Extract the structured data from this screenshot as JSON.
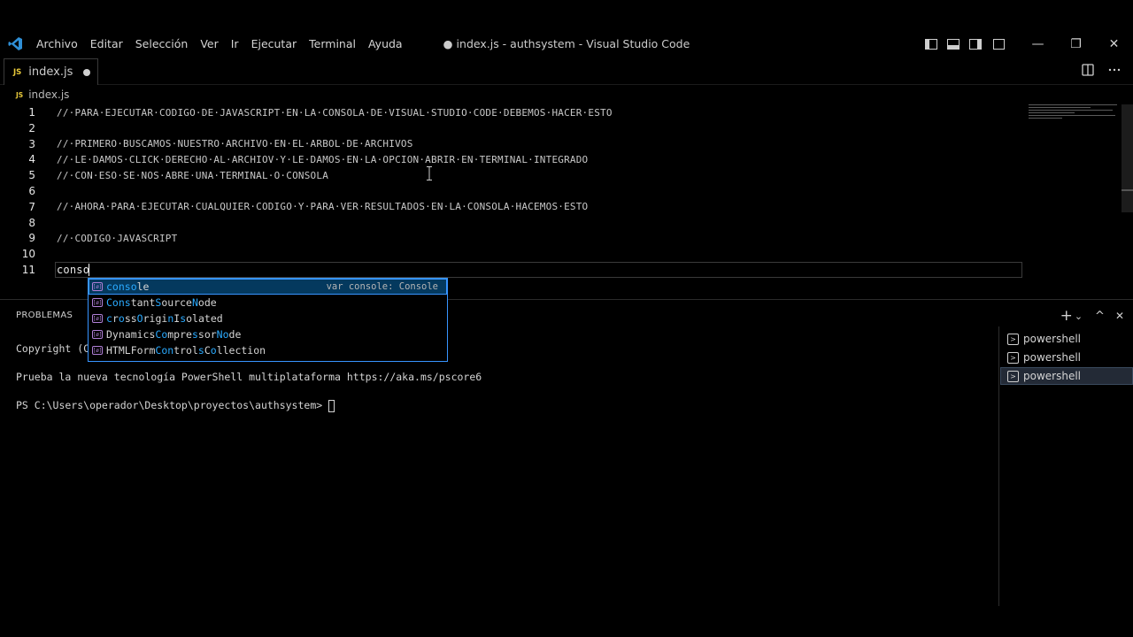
{
  "titlebar": {
    "menu": [
      "Archivo",
      "Editar",
      "Selección",
      "Ver",
      "Ir",
      "Ejecutar",
      "Terminal",
      "Ayuda"
    ],
    "window_title": "● index.js - authsystem - Visual Studio Code",
    "minimize": "—",
    "restore": "❐",
    "close": "✕"
  },
  "tabs": {
    "badge": "JS",
    "active_label": "index.js"
  },
  "breadcrumb": {
    "badge": "JS",
    "file": "index.js"
  },
  "editor": {
    "lines": [
      {
        "n": "1",
        "text": "//·PARA·EJECUTAR·CODIGO·DE·JAVASCRIPT·EN·LA·CONSOLA·DE·VISUAL·STUDIO·CODE·DEBEMOS·HACER·ESTO"
      },
      {
        "n": "2",
        "text": ""
      },
      {
        "n": "3",
        "text": "//·PRIMERO·BUSCAMOS·NUESTRO·ARCHIVO·EN·EL·ARBOL·DE·ARCHIVOS"
      },
      {
        "n": "4",
        "text": "//·LE·DAMOS·CLICK·DERECHO·AL·ARCHIOV·Y·LE·DAMOS·EN·LA·OPCION·ABRIR·EN·TERMINAL·INTEGRADO"
      },
      {
        "n": "5",
        "text": "//·CON·ESO·SE·NOS·ABRE·UNA·TERMINAL·O·CONSOLA"
      },
      {
        "n": "6",
        "text": ""
      },
      {
        "n": "7",
        "text": "//·AHORA·PARA·EJECUTAR·CUALQUIER·CODIGO·Y·PARA·VER·RESULTADOS·EN·LA·CONSOLA·HACEMOS·ESTO"
      },
      {
        "n": "8",
        "text": ""
      },
      {
        "n": "9",
        "text": "//·CODIGO·JAVASCRIPT"
      },
      {
        "n": "10",
        "text": ""
      },
      {
        "n": "11",
        "text": "conso"
      }
    ]
  },
  "suggest": {
    "icon": "[ø]",
    "items": [
      {
        "parts": [
          {
            "t": "conso",
            "h": true
          },
          {
            "t": "le",
            "h": false
          }
        ],
        "detail": "var console: Console",
        "selected": true
      },
      {
        "parts": [
          {
            "t": "Cons",
            "h": true
          },
          {
            "t": "tant",
            "h": false
          },
          {
            "t": "S",
            "h": true
          },
          {
            "t": "ource",
            "h": false
          },
          {
            "t": "N",
            "h": true
          },
          {
            "t": "ode",
            "h": false
          }
        ],
        "detail": "",
        "selected": false
      },
      {
        "parts": [
          {
            "t": "c",
            "h": true
          },
          {
            "t": "r",
            "h": false
          },
          {
            "t": "o",
            "h": true
          },
          {
            "t": "ss",
            "h": false
          },
          {
            "t": "O",
            "h": true
          },
          {
            "t": "rigi",
            "h": false
          },
          {
            "t": "n",
            "h": true
          },
          {
            "t": "I",
            "h": false
          },
          {
            "t": "s",
            "h": true
          },
          {
            "t": "olated",
            "h": false
          }
        ],
        "detail": "",
        "selected": false
      },
      {
        "parts": [
          {
            "t": "Dynamics",
            "h": false
          },
          {
            "t": "Co",
            "h": true
          },
          {
            "t": "mpre",
            "h": false
          },
          {
            "t": "s",
            "h": true
          },
          {
            "t": "sor",
            "h": false
          },
          {
            "t": "No",
            "h": true
          },
          {
            "t": "de",
            "h": false
          }
        ],
        "detail": "",
        "selected": false
      },
      {
        "parts": [
          {
            "t": "HTMLForm",
            "h": false
          },
          {
            "t": "Con",
            "h": true
          },
          {
            "t": "trol",
            "h": false
          },
          {
            "t": "s",
            "h": true
          },
          {
            "t": "C",
            "h": false
          },
          {
            "t": "o",
            "h": true
          },
          {
            "t": "llection",
            "h": false
          }
        ],
        "detail": "",
        "selected": false
      }
    ]
  },
  "panel": {
    "tab_label": "PROBLEMAS",
    "actions": {
      "add": "+",
      "dropdown": "⌄",
      "maximize": "^",
      "close": "✕"
    },
    "terminal_lines": [
      "Copyright (C",
      "",
      "Prueba la nueva tecnología PowerShell multiplataforma https://aka.ms/pscore6",
      "",
      "PS C:\\Users\\operador\\Desktop\\proyectos\\authsystem> "
    ],
    "terminals": [
      {
        "label": "powershell",
        "active": false
      },
      {
        "label": "powershell",
        "active": false
      },
      {
        "label": "powershell",
        "active": true
      }
    ],
    "term_icon": ">"
  }
}
